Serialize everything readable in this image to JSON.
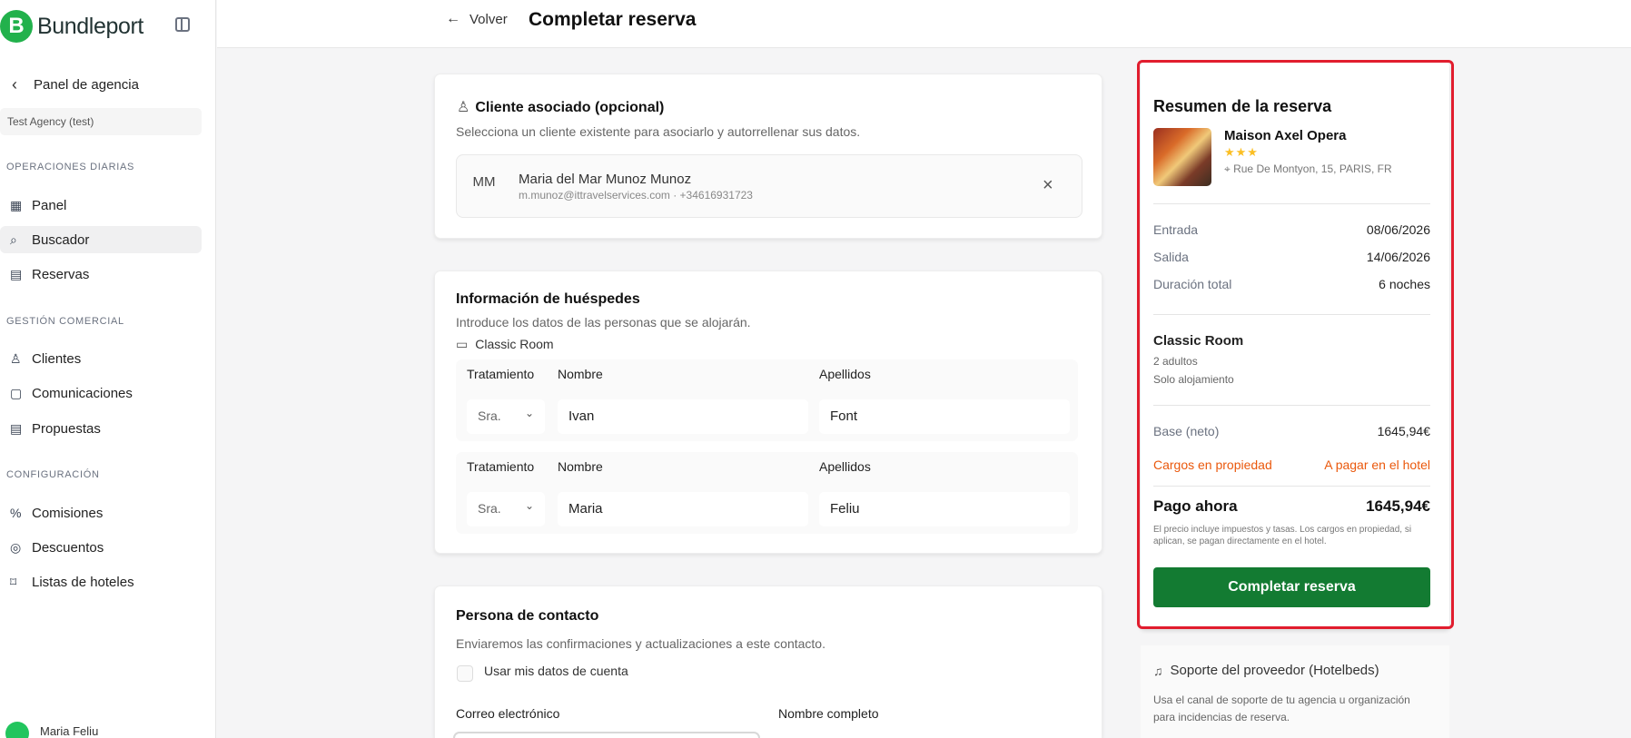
{
  "app": {
    "brand": "Bundleport",
    "logo_letter": "B"
  },
  "sidebar": {
    "back_label": "Panel de agencia",
    "agency": "Test Agency (test)",
    "sections": [
      {
        "title": "OPERACIONES DIARIAS",
        "items": [
          {
            "label": "Panel",
            "icon": "layout-grid-icon"
          },
          {
            "label": "Buscador",
            "icon": "search-icon",
            "active": true
          },
          {
            "label": "Reservas",
            "icon": "calendar-icon"
          }
        ]
      },
      {
        "title": "GESTIÓN COMERCIAL",
        "items": [
          {
            "label": "Clientes",
            "icon": "users-icon"
          },
          {
            "label": "Comunicaciones",
            "icon": "message-icon"
          },
          {
            "label": "Propuestas",
            "icon": "document-icon"
          }
        ]
      },
      {
        "title": "CONFIGURACIÓN",
        "items": [
          {
            "label": "Comisiones",
            "icon": "percent-icon"
          },
          {
            "label": "Descuentos",
            "icon": "discount-icon"
          },
          {
            "label": "Listas de hoteles",
            "icon": "bookmark-icon"
          }
        ]
      }
    ],
    "user_name": "Maria Feliu"
  },
  "header": {
    "back": "Volver",
    "title": "Completar reserva"
  },
  "client_card": {
    "title": "Cliente asociado (opcional)",
    "description": "Selecciona un cliente existente para asociarlo y autorrellenar sus datos.",
    "initials": "MM",
    "name": "Maria del Mar Munoz Munoz",
    "meta": "m.munoz@ittravelservices.com · +34616931723"
  },
  "guests": {
    "title": "Información de huéspedes",
    "description": "Introduce los datos de las personas que se alojarán.",
    "room": "Classic Room",
    "labels": {
      "treatment": "Tratamiento",
      "name": "Nombre",
      "surname": "Apellidos"
    },
    "rows": [
      {
        "treatment": "Sra.",
        "name": "Ivan",
        "surname": "Font"
      },
      {
        "treatment": "Sra.",
        "name": "Maria",
        "surname": "Feliu"
      }
    ]
  },
  "contact": {
    "title": "Persona de contacto",
    "description": "Enviaremos las confirmaciones y actualizaciones a este contacto.",
    "use_account": "Usar mis datos de cuenta",
    "email_label": "Correo electrónico",
    "full_name_label": "Nombre completo"
  },
  "summary": {
    "title": "Resumen de la reserva",
    "hotel": "Maison Axel Opera",
    "stars": "★★★",
    "address": "Rue De Montyon, 15, PARIS, FR",
    "check_in_label": "Entrada",
    "check_in": "08/06/2026",
    "check_out_label": "Salida",
    "check_out": "14/06/2026",
    "duration_label": "Duración total",
    "duration": "6 noches",
    "room": "Classic Room",
    "occupancy": "2 adultos",
    "board": "Solo alojamiento",
    "base_label": "Base (neto)",
    "base": "1645,94€",
    "charges_label": "Cargos en propiedad",
    "charges": "A pagar en el hotel",
    "pay_now_label": "Pago ahora",
    "pay_now": "1645,94€",
    "note": "El precio incluye impuestos y tasas. Los cargos en propiedad, si aplican, se pagan directamente en el hotel.",
    "button": "Completar reserva"
  },
  "support": {
    "title": "Soporte del proveedor (Hotelbeds)",
    "text": "Usa el canal de soporte de tu agencia u organización para incidencias de reserva."
  },
  "colors": {
    "brand_green": "#22b14c",
    "button_green": "#137b32",
    "orange": "#ea580c",
    "highlight_red": "#e11d2e"
  }
}
